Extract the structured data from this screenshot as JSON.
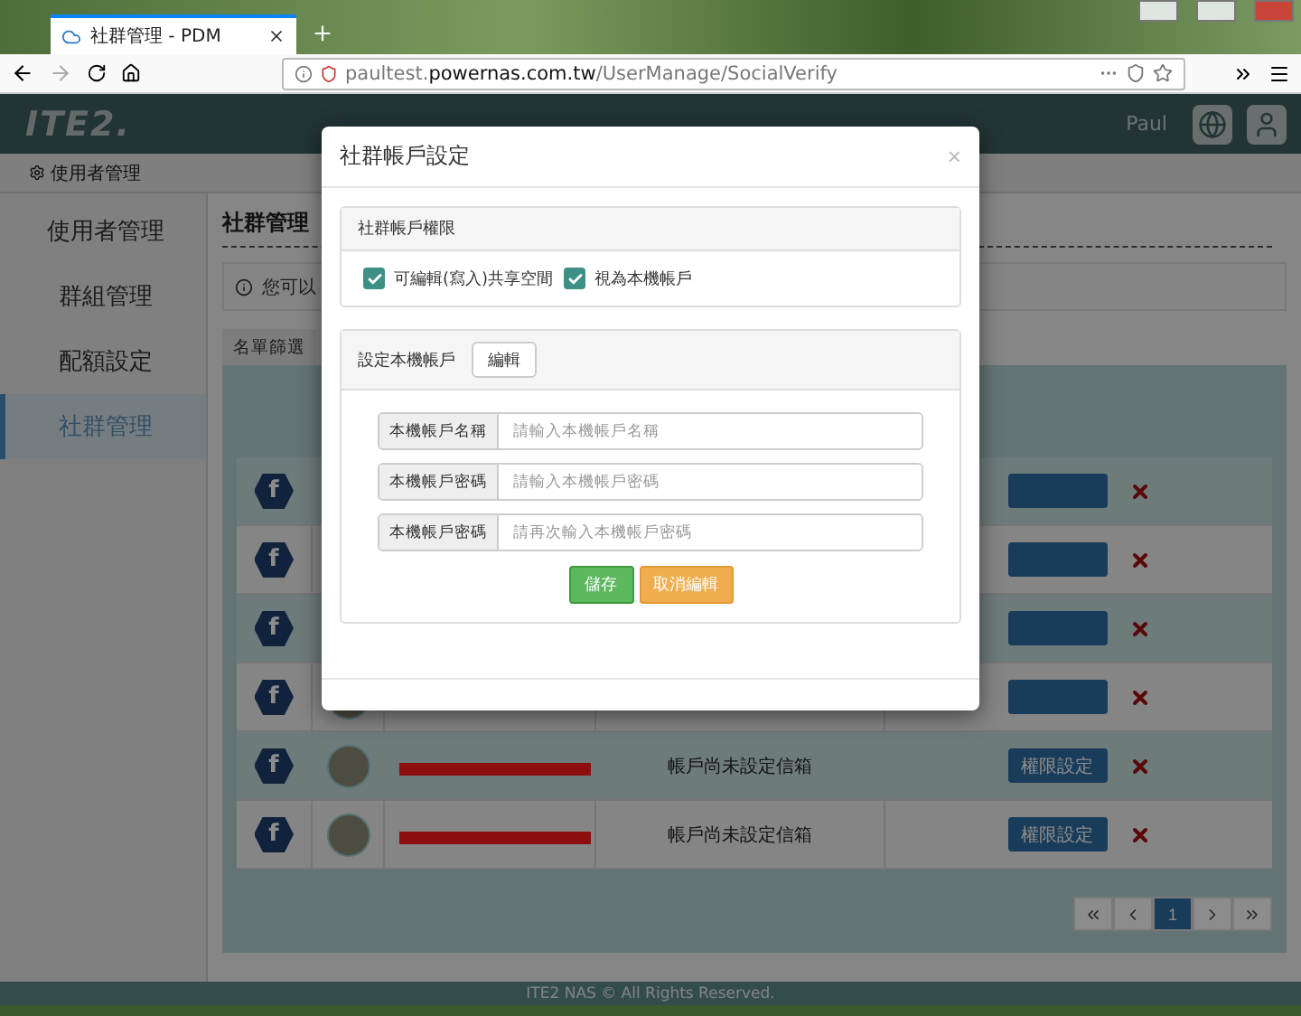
{
  "browser": {
    "tab_title": "社群管理 - PDM",
    "url_prefix": "paultest.",
    "url_domain": "powernas.com.tw",
    "url_path": "/UserManage/SocialVerify"
  },
  "header": {
    "logo": "ITE2.",
    "user": "Paul"
  },
  "breadcrumb": "使用者管理",
  "sidebar": {
    "items": [
      {
        "label": "使用者管理",
        "selected": false
      },
      {
        "label": "群組管理",
        "selected": false
      },
      {
        "label": "配額設定",
        "selected": false
      },
      {
        "label": "社群管理",
        "selected": true
      }
    ]
  },
  "main": {
    "title": "社群管理",
    "info": "您可以",
    "tab": "名單篩選",
    "rows": [
      {
        "kind": "covered",
        "network": "f"
      },
      {
        "kind": "covered",
        "network": "f"
      },
      {
        "kind": "covered",
        "network": "f"
      },
      {
        "kind": "covered",
        "network": "f"
      },
      {
        "kind": "full",
        "network": "f",
        "status": "帳戶尚未設定信箱",
        "button": "權限設定"
      },
      {
        "kind": "full",
        "network": "f",
        "status": "帳戶尚未設定信箱",
        "button": "權限設定"
      }
    ],
    "pagination": [
      {
        "kind": "first",
        "selected": false
      },
      {
        "kind": "prev",
        "selected": false
      },
      {
        "kind": "page",
        "label": "1",
        "selected": true
      },
      {
        "kind": "next",
        "selected": false
      },
      {
        "kind": "last",
        "selected": false
      }
    ]
  },
  "footer": "ITE2 NAS © All Rights Reserved.",
  "modal": {
    "title": "社群帳戶設定",
    "close": "×",
    "permissions": {
      "title": "社群帳戶權限",
      "options": [
        {
          "label": "可編輯(寫入)共享空間",
          "checked": true
        },
        {
          "label": "視為本機帳戶",
          "checked": true
        }
      ]
    },
    "local": {
      "title": "設定本機帳戶",
      "edit_button": "編輯",
      "fields": [
        {
          "label": "本機帳戶名稱",
          "placeholder": "請輸入本機帳戶名稱"
        },
        {
          "label": "本機帳戶密碼",
          "placeholder": "請輸入本機帳戶密碼"
        },
        {
          "label": "本機帳戶密碼",
          "placeholder": "請再次輸入本機帳戶密碼"
        }
      ],
      "save": "儲存",
      "cancel": "取消編輯"
    }
  }
}
